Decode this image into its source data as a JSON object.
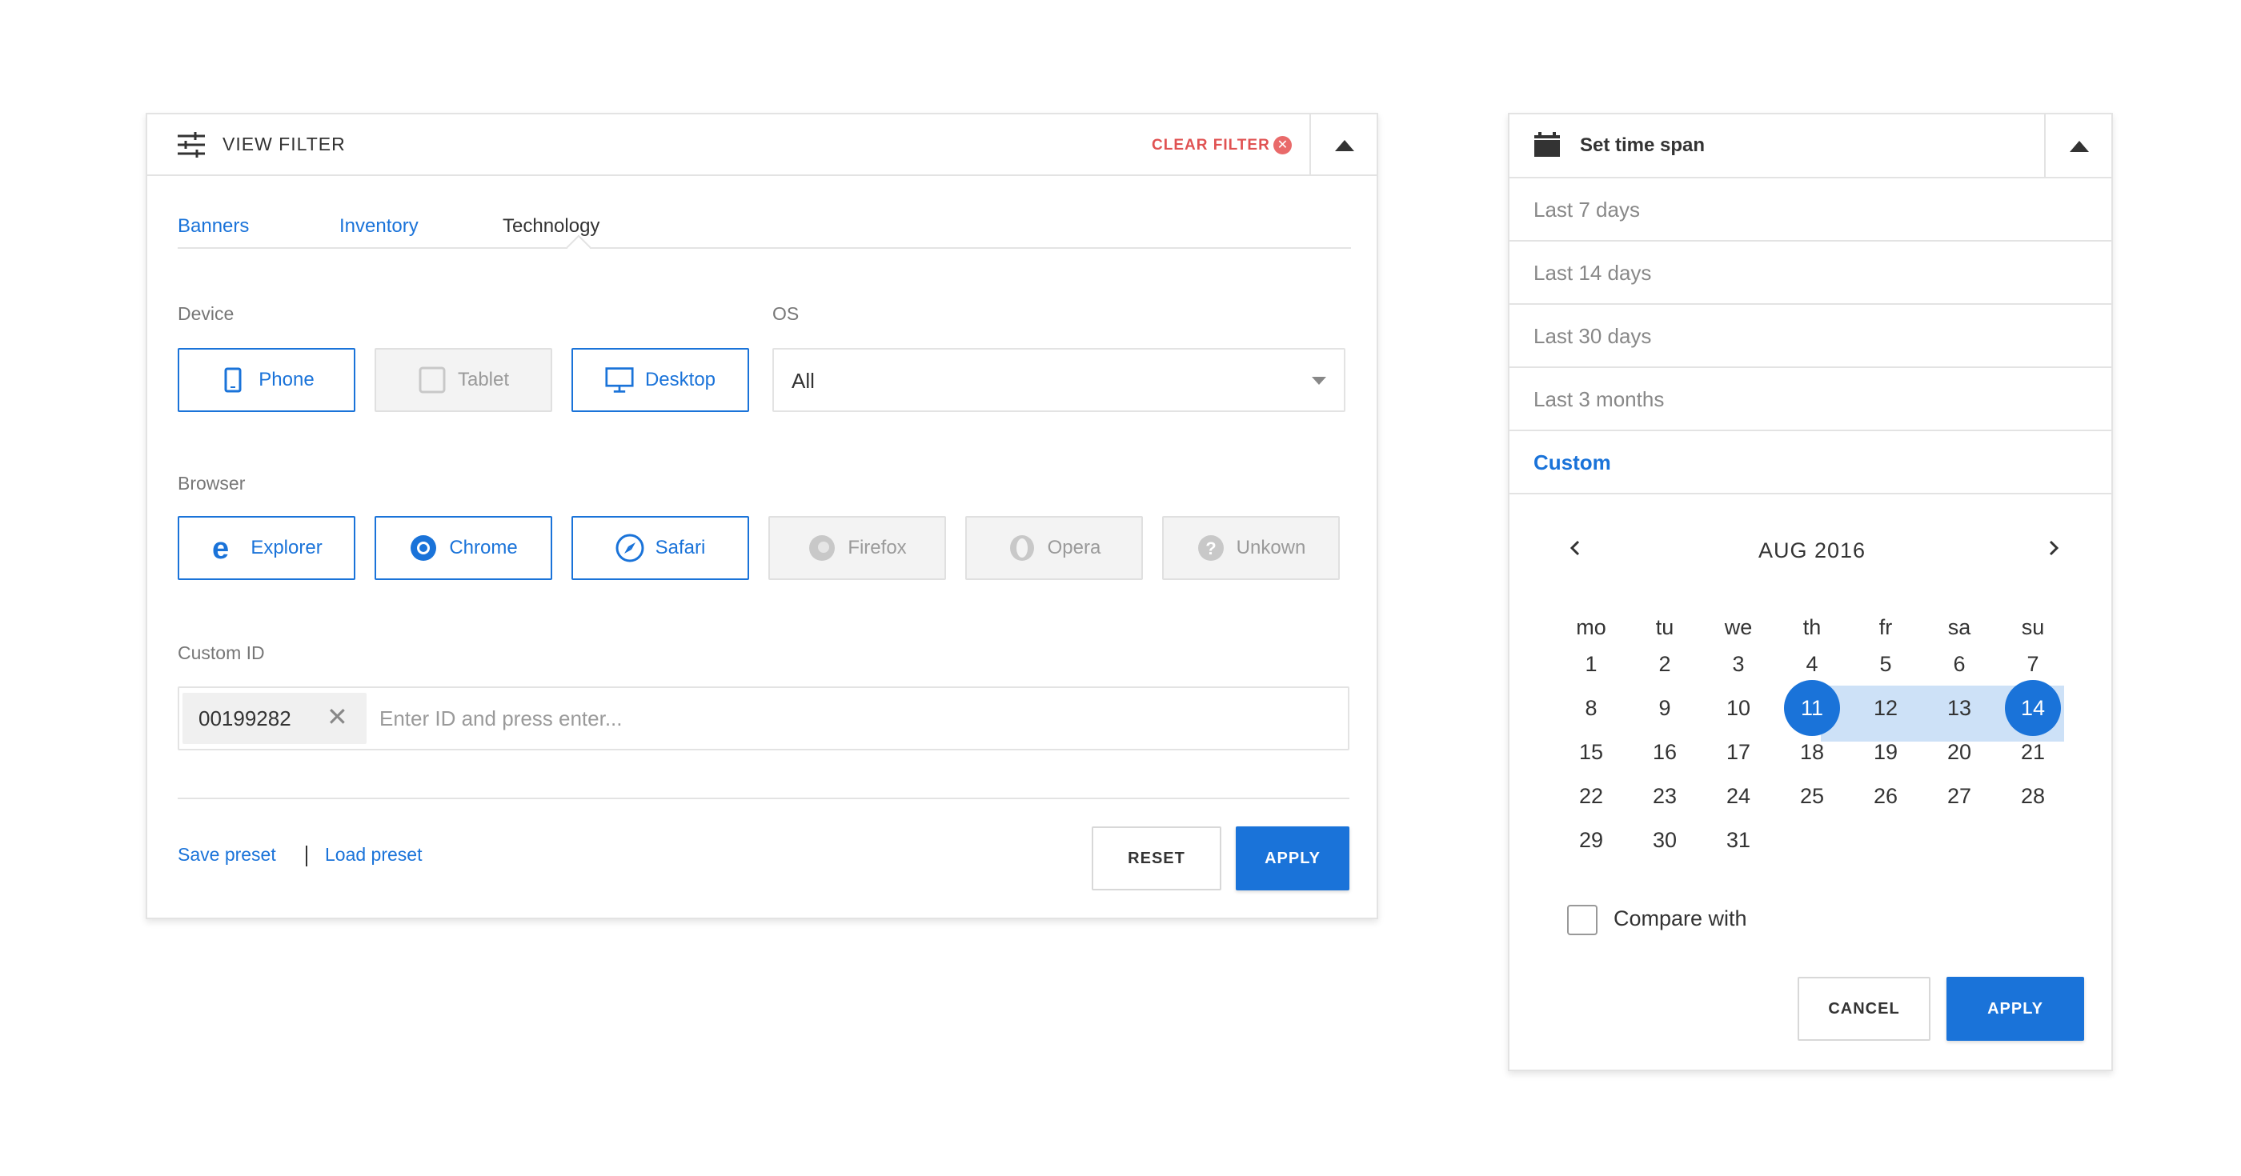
{
  "filter": {
    "title": "VIEW FILTER",
    "clear_label": "CLEAR FILTER",
    "icon": "sliders-icon",
    "tabs": [
      {
        "label": "Banners",
        "active": false
      },
      {
        "label": "Inventory",
        "active": false
      },
      {
        "label": "Technology",
        "active": true
      }
    ],
    "device": {
      "label": "Device",
      "options": [
        {
          "label": "Phone",
          "icon": "phone-icon",
          "state": "selected"
        },
        {
          "label": "Tablet",
          "icon": "tablet-icon",
          "state": "disabled"
        },
        {
          "label": "Desktop",
          "icon": "desktop-icon",
          "state": "selected"
        }
      ]
    },
    "os": {
      "label": "OS",
      "value": "All"
    },
    "browser": {
      "label": "Browser",
      "options": [
        {
          "label": "Explorer",
          "icon": "explorer-icon",
          "state": "selected"
        },
        {
          "label": "Chrome",
          "icon": "chrome-icon",
          "state": "selected"
        },
        {
          "label": "Safari",
          "icon": "safari-icon",
          "state": "selected"
        },
        {
          "label": "Firefox",
          "icon": "firefox-icon",
          "state": "disabled"
        },
        {
          "label": "Opera",
          "icon": "opera-icon",
          "state": "disabled"
        },
        {
          "label": "Unkown",
          "icon": "question-icon",
          "state": "disabled"
        }
      ]
    },
    "custom_id": {
      "label": "Custom ID",
      "chips": [
        "00199282"
      ],
      "placeholder": "Enter ID and press enter..."
    },
    "save_preset": "Save preset",
    "load_preset": "Load preset",
    "reset_label": "RESET",
    "apply_label": "APPLY"
  },
  "timespan": {
    "title": "Set time span",
    "icon": "calendar-icon",
    "ranges": [
      {
        "label": "Last 7 days",
        "active": false
      },
      {
        "label": "Last 14 days",
        "active": false
      },
      {
        "label": "Last 30 days",
        "active": false
      },
      {
        "label": "Last 3 months",
        "active": false
      },
      {
        "label": "Custom",
        "active": true
      }
    ],
    "calendar": {
      "month_label": "AUG 2016",
      "weekdays": [
        "mo",
        "tu",
        "we",
        "th",
        "fr",
        "sa",
        "su"
      ],
      "weeks": [
        [
          "1",
          "2",
          "3",
          "4",
          "5",
          "6",
          "7"
        ],
        [
          "8",
          "9",
          "10",
          "11",
          "12",
          "13",
          "14"
        ],
        [
          "15",
          "16",
          "17",
          "18",
          "19",
          "20",
          "21"
        ],
        [
          "22",
          "23",
          "24",
          "25",
          "26",
          "27",
          "28"
        ],
        [
          "29",
          "30",
          "31",
          "",
          "",
          "",
          ""
        ]
      ],
      "selected_start": "11",
      "selected_end": "14"
    },
    "compare_label": "Compare with",
    "compare_checked": false,
    "cancel_label": "CANCEL",
    "apply_label": "APPLY"
  },
  "colors": {
    "accent": "#1a73d9",
    "danger": "#e05252",
    "range_fill": "#cde1f7",
    "border": "#e3e3e3"
  }
}
